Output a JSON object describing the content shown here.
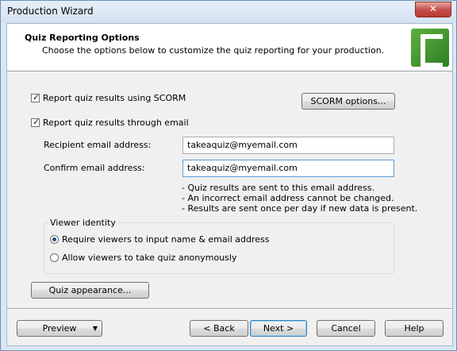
{
  "window": {
    "title": "Production Wizard",
    "close_label": "✕"
  },
  "header": {
    "title": "Quiz Reporting Options",
    "subtitle": "Choose the options below to customize the quiz reporting for your production.",
    "logo_icon": "camtasia-logo-icon"
  },
  "scorm": {
    "checkbox_label": "Report quiz results using SCORM",
    "checked": true,
    "options_button": "SCORM options..."
  },
  "email": {
    "checkbox_label": "Report quiz results through email",
    "checked": true,
    "recipient_label": "Recipient email address:",
    "recipient_value": "takeaquiz@myemail.com",
    "confirm_label": "Confirm email address:",
    "confirm_value": "takeaquiz@myemail.com",
    "notes": [
      "-  Quiz results are sent to this email address.",
      "-  An incorrect email address cannot be changed.",
      "-  Results are sent once per day if new data is present."
    ]
  },
  "viewer_identity": {
    "title": "Viewer identity",
    "option_require": "Require viewers to input name & email address",
    "option_anonymous": "Allow viewers to take quiz anonymously",
    "selected": "require"
  },
  "quiz_appearance_button": "Quiz appearance...",
  "footer": {
    "preview": "Preview",
    "back": "< Back",
    "next": "Next >",
    "cancel": "Cancel",
    "help": "Help"
  }
}
